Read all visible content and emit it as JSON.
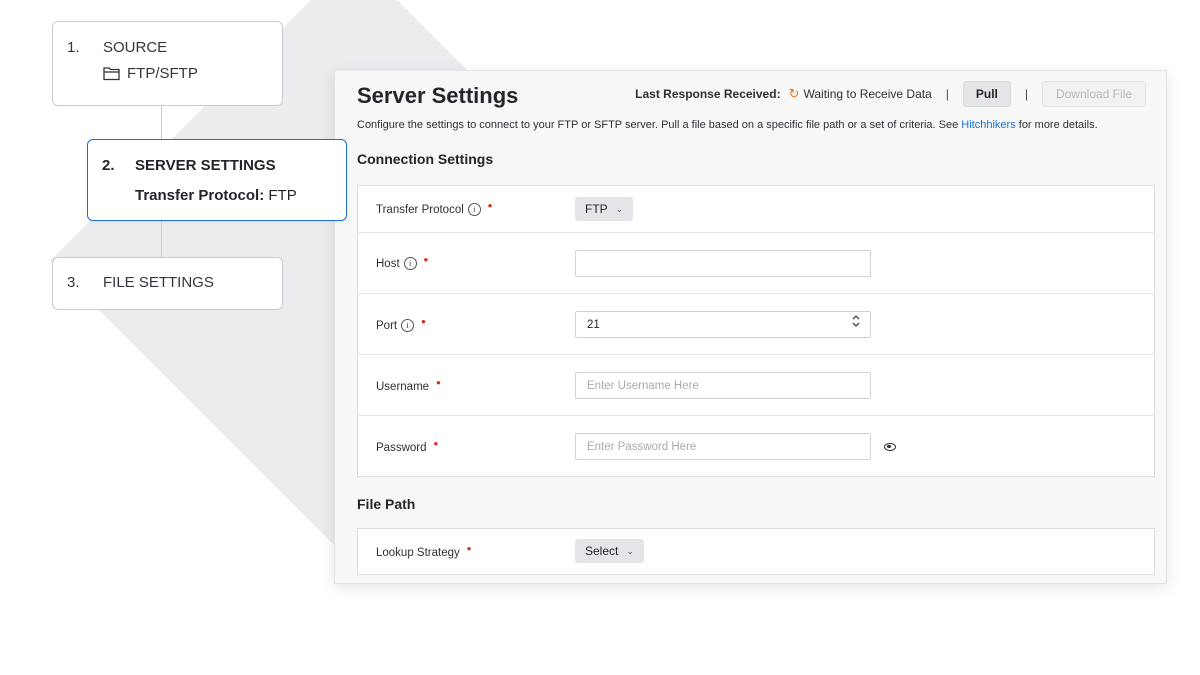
{
  "steps": [
    {
      "number": "1.",
      "label": "SOURCE",
      "sub_icon": "folder-icon",
      "sub_label": "FTP/SFTP"
    },
    {
      "number": "2.",
      "label": "SERVER SETTINGS",
      "detail_key": "Transfer Protocol:",
      "detail_value": "FTP",
      "active": true
    },
    {
      "number": "3.",
      "label": "FILE SETTINGS"
    }
  ],
  "panel": {
    "title": "Server Settings",
    "last_response_label": "Last Response Received:",
    "response_status": "Waiting to Receive Data",
    "separator": "|",
    "pull_button": "Pull",
    "download_button": "Download File",
    "description_prefix": "Configure the settings to connect to your FTP or SFTP server. Pull a file based on a specific file path or a set of criteria. See ",
    "description_link": "Hitchhikers",
    "description_suffix": " for more details."
  },
  "connection_settings": {
    "title": "Connection Settings",
    "transfer_protocol": {
      "label": "Transfer Protocol",
      "value": "FTP",
      "required_mark": "•"
    },
    "host": {
      "label": "Host",
      "value": "",
      "placeholder": "",
      "required_mark": "•"
    },
    "port": {
      "label": "Port",
      "value": "21",
      "required_mark": "•"
    },
    "username": {
      "label": "Username",
      "value": "",
      "placeholder": "Enter Username Here",
      "required_mark": "•"
    },
    "password": {
      "label": "Password",
      "value": "",
      "placeholder": "Enter Password Here",
      "required_mark": "•"
    }
  },
  "file_path": {
    "title": "File Path",
    "lookup_strategy": {
      "label": "Lookup Strategy",
      "value": "Select",
      "required_mark": "•"
    }
  },
  "icons": {
    "info": "ⓘ",
    "chevron": "⌄",
    "refresh": "↻",
    "stepper": "⇕"
  },
  "colors": {
    "accent_blue": "#1f6fd1",
    "required_red": "#d2311e",
    "status_orange": "#ea7a1c"
  }
}
